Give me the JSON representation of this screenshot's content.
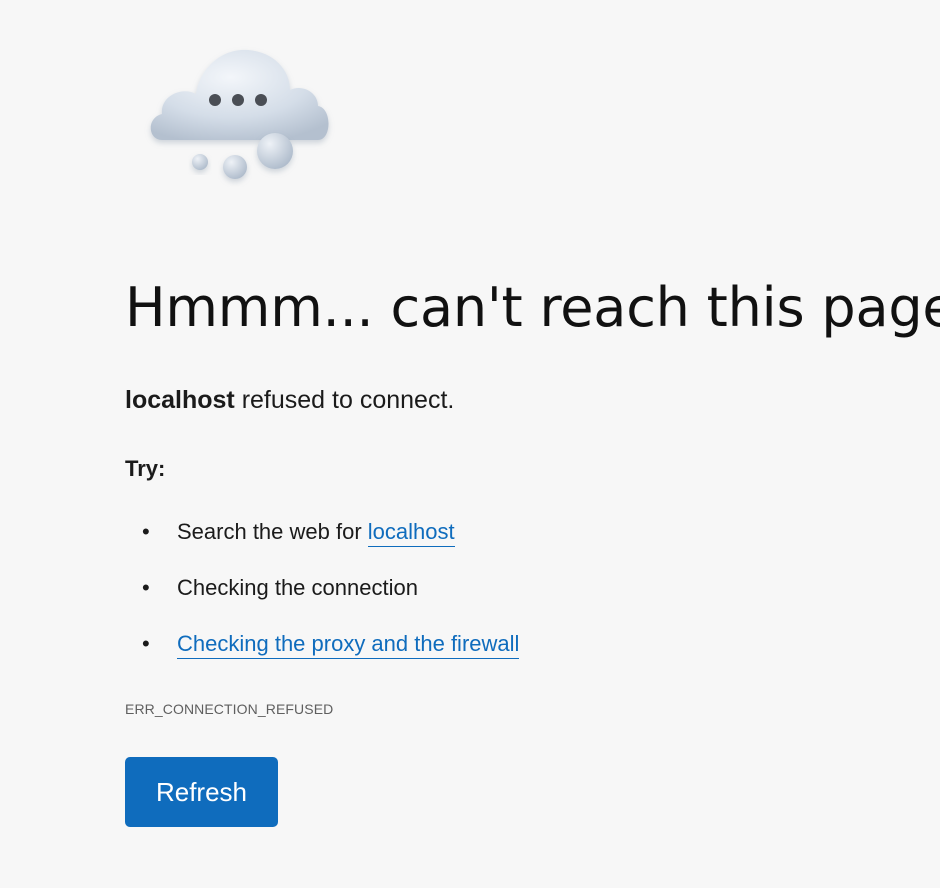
{
  "illustration": {
    "icon": "cloud-thinking-icon"
  },
  "title": "Hmmm... can't reach this page",
  "error": {
    "host": "localhost",
    "message": " refused to connect."
  },
  "try_label": "Try:",
  "suggestions": [
    {
      "prefix": "Search the web for ",
      "link": "localhost"
    },
    {
      "text": "Checking the connection"
    },
    {
      "link": "Checking the proxy and the firewall"
    }
  ],
  "error_code": "ERR_CONNECTION_REFUSED",
  "refresh_label": "Refresh",
  "colors": {
    "background": "#f7f7f7",
    "link": "#0f6cbd",
    "button": "#0f6cbd",
    "button_text": "#ffffff"
  }
}
